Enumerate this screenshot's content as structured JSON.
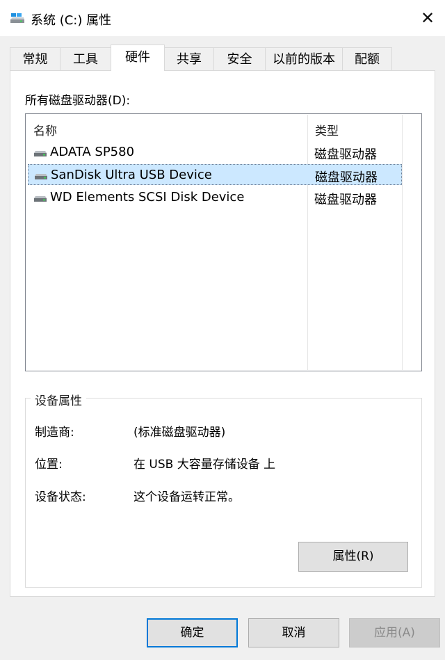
{
  "window": {
    "title": "系统 (C:) 属性",
    "close_glyph": "✕"
  },
  "tabs": [
    {
      "label": "常规",
      "active": false
    },
    {
      "label": "工具",
      "active": false
    },
    {
      "label": "硬件",
      "active": true
    },
    {
      "label": "共享",
      "active": false
    },
    {
      "label": "安全",
      "active": false
    },
    {
      "label": "以前的版本",
      "active": false
    },
    {
      "label": "配额",
      "active": false
    }
  ],
  "hardware": {
    "list_label": "所有磁盘驱动器(D):",
    "columns": {
      "name": "名称",
      "type": "类型"
    },
    "drives": [
      {
        "name": "ADATA SP580",
        "type": "磁盘驱动器",
        "selected": false
      },
      {
        "name": "SanDisk Ultra USB Device",
        "type": "磁盘驱动器",
        "selected": true
      },
      {
        "name": "WD Elements SCSI Disk Device",
        "type": "磁盘驱动器",
        "selected": false
      }
    ],
    "properties": {
      "group_title": "设备属性",
      "manufacturer_label": "制造商:",
      "manufacturer_value": "(标准磁盘驱动器)",
      "location_label": "位置:",
      "location_value": "在 USB 大容量存储设备 上",
      "status_label": "设备状态:",
      "status_value": "这个设备运转正常。",
      "button": "属性(R)"
    }
  },
  "footer": {
    "ok": "确定",
    "cancel": "取消",
    "apply": "应用(A)"
  },
  "colors": {
    "selection": "#cce8ff",
    "default_button_border": "#0078d7"
  }
}
